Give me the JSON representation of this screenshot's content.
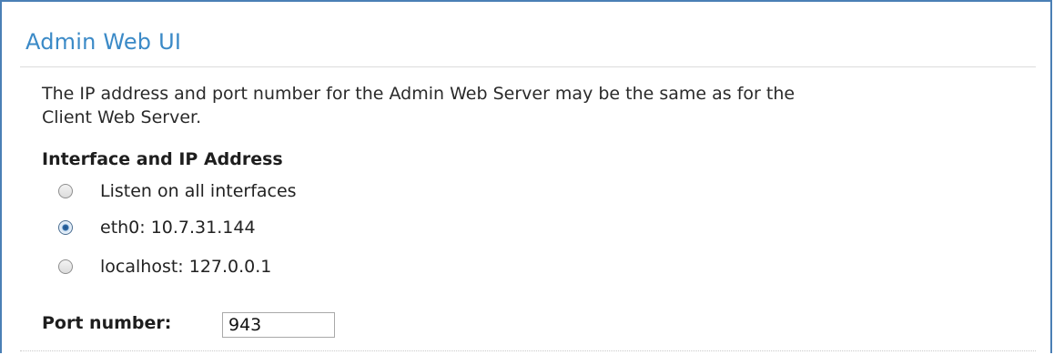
{
  "section": {
    "title": "Admin Web UI",
    "description": "The IP address and port number for the Admin Web Server may be the same as for the Client Web Server."
  },
  "interface": {
    "label": "Interface and IP Address",
    "options": [
      {
        "label": "Listen on all interfaces",
        "checked": false
      },
      {
        "label": "eth0: 10.7.31.144",
        "checked": true
      },
      {
        "label": "localhost: 127.0.0.1",
        "checked": false
      }
    ],
    "selected": "eth0: 10.7.31.144"
  },
  "port": {
    "label": "Port number:",
    "value": "943"
  },
  "colors": {
    "frame_border": "#4a7fb5",
    "title": "#3b8ac7",
    "radio_checked": "#2e6aa8"
  }
}
